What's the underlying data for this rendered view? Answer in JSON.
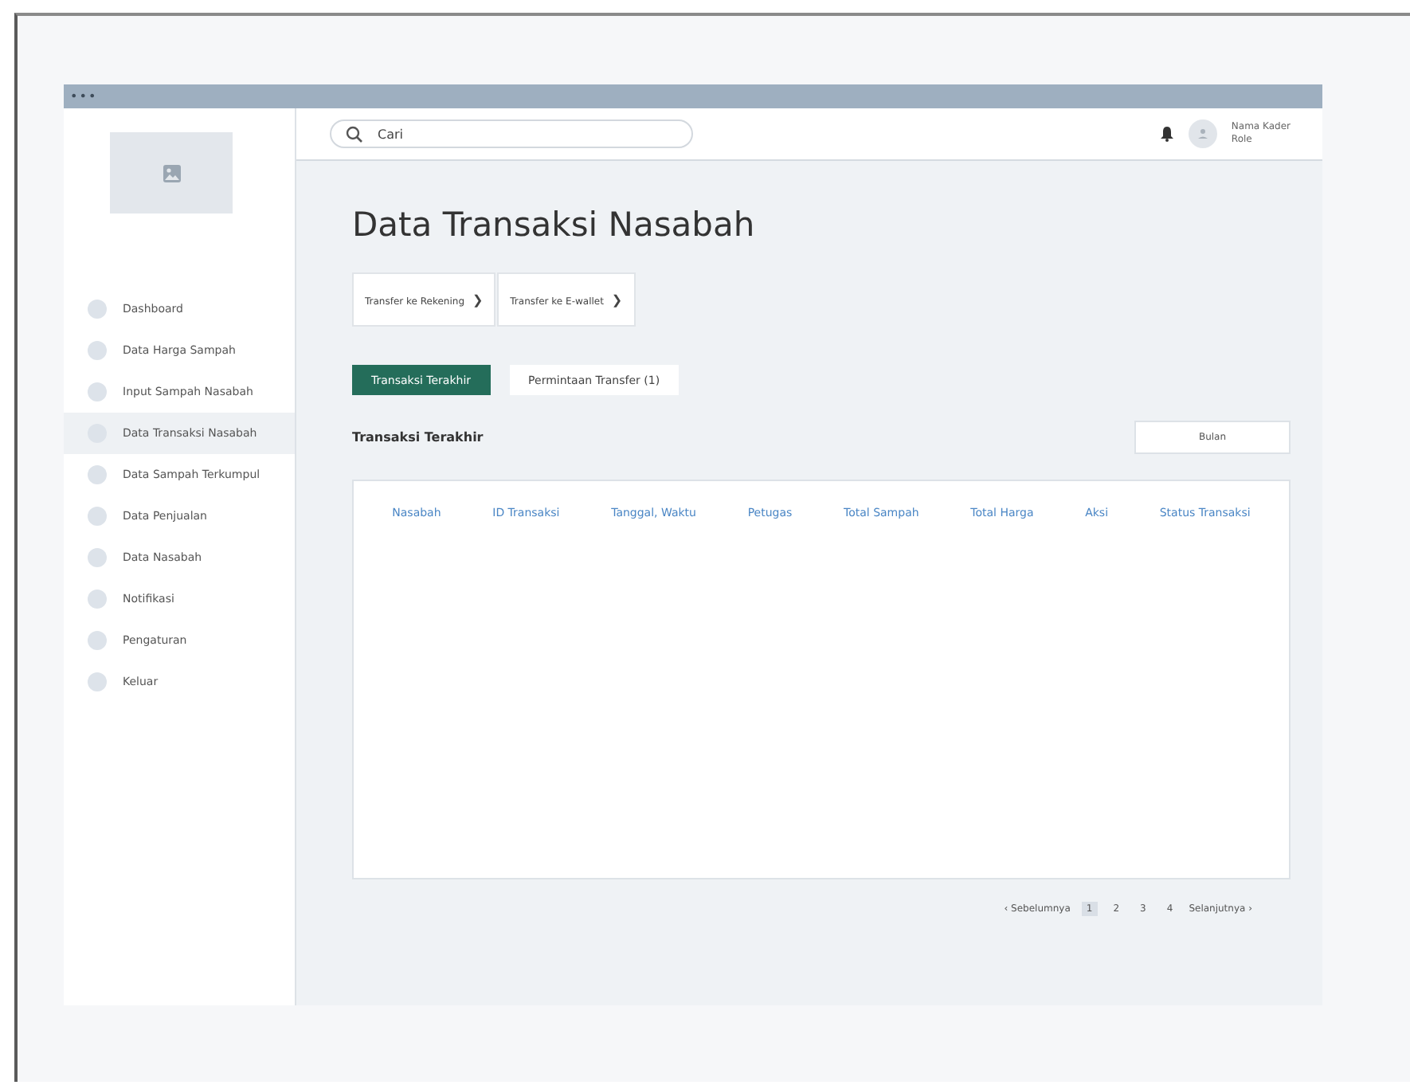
{
  "window": {
    "title_dots": "•••"
  },
  "sidebar": {
    "items": [
      {
        "label": "Dashboard",
        "selected": false
      },
      {
        "label": "Data Harga Sampah",
        "selected": false
      },
      {
        "label": "Input Sampah Nasabah",
        "selected": false
      },
      {
        "label": "Data Transaksi Nasabah",
        "selected": true
      },
      {
        "label": "Data Sampah Terkumpul",
        "selected": false
      },
      {
        "label": "Data Penjualan",
        "selected": false
      },
      {
        "label": "Data Nasabah",
        "selected": false
      },
      {
        "label": "Notifikasi",
        "selected": false
      },
      {
        "label": "Pengaturan",
        "selected": false
      },
      {
        "label": "Keluar",
        "selected": false
      }
    ]
  },
  "header": {
    "search": {
      "placeholder": "Cari"
    },
    "user": {
      "name": "Nama Kader",
      "role": "Role"
    }
  },
  "page_title": "Data Transaksi Nasabah",
  "actions": [
    {
      "label": "Transfer ke Rekening",
      "arrow": "❯"
    },
    {
      "label": "Transfer ke E-wallet",
      "arrow": "❯"
    }
  ],
  "tabs": [
    {
      "label": "Transaksi Terakhir",
      "selected": true
    },
    {
      "label": "Permintaan Transfer (1)",
      "selected": false
    }
  ],
  "section": {
    "title": "Transaksi Terakhir",
    "filter": "Bulan"
  },
  "table": {
    "columns": [
      "Nasabah",
      "ID Transaksi",
      "Tanggal, Waktu",
      "Petugas",
      "Total Sampah",
      "Total Harga",
      "Aksi",
      "Status Transaksi"
    ]
  },
  "pagination": {
    "prev": "Sebelumnya",
    "prev_arrow": "‹",
    "next": "Selanjutnya",
    "next_arrow": "›",
    "pages": [
      {
        "label": "1",
        "selected": true
      },
      {
        "label": "2",
        "selected": false
      },
      {
        "label": "3",
        "selected": false
      },
      {
        "label": "4",
        "selected": false
      }
    ]
  }
}
